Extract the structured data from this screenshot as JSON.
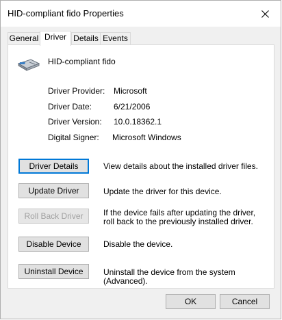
{
  "window": {
    "title": "HID-compliant fido Properties"
  },
  "tabs": [
    {
      "label": "General"
    },
    {
      "label": "Driver"
    },
    {
      "label": "Details"
    },
    {
      "label": "Events"
    }
  ],
  "device": {
    "name": "HID-compliant fido",
    "icon": "hid-device-icon"
  },
  "driver_info": [
    {
      "label": "Driver Provider:",
      "value": "Microsoft"
    },
    {
      "label": "Driver Date:",
      "value": "6/21/2006"
    },
    {
      "label": "Driver Version:",
      "value": "10.0.18362.1"
    },
    {
      "label": "Digital Signer:",
      "value": "Microsoft Windows"
    }
  ],
  "actions": [
    {
      "label": "Driver Details",
      "description": "View details about the installed driver files."
    },
    {
      "label": "Update Driver",
      "description": "Update the driver for this device."
    },
    {
      "label": "Roll Back Driver",
      "description": "If the device fails after updating the driver, roll back to the previously installed driver."
    },
    {
      "label": "Disable Device",
      "description": "Disable the device."
    },
    {
      "label": "Uninstall Device",
      "description": "Uninstall the device from the system (Advanced)."
    }
  ],
  "footer": {
    "ok_label": "OK",
    "cancel_label": "Cancel"
  },
  "colors": {
    "accent": "#0078d7",
    "dialog_bg": "#f0f0f0",
    "panel_bg": "#ffffff"
  }
}
